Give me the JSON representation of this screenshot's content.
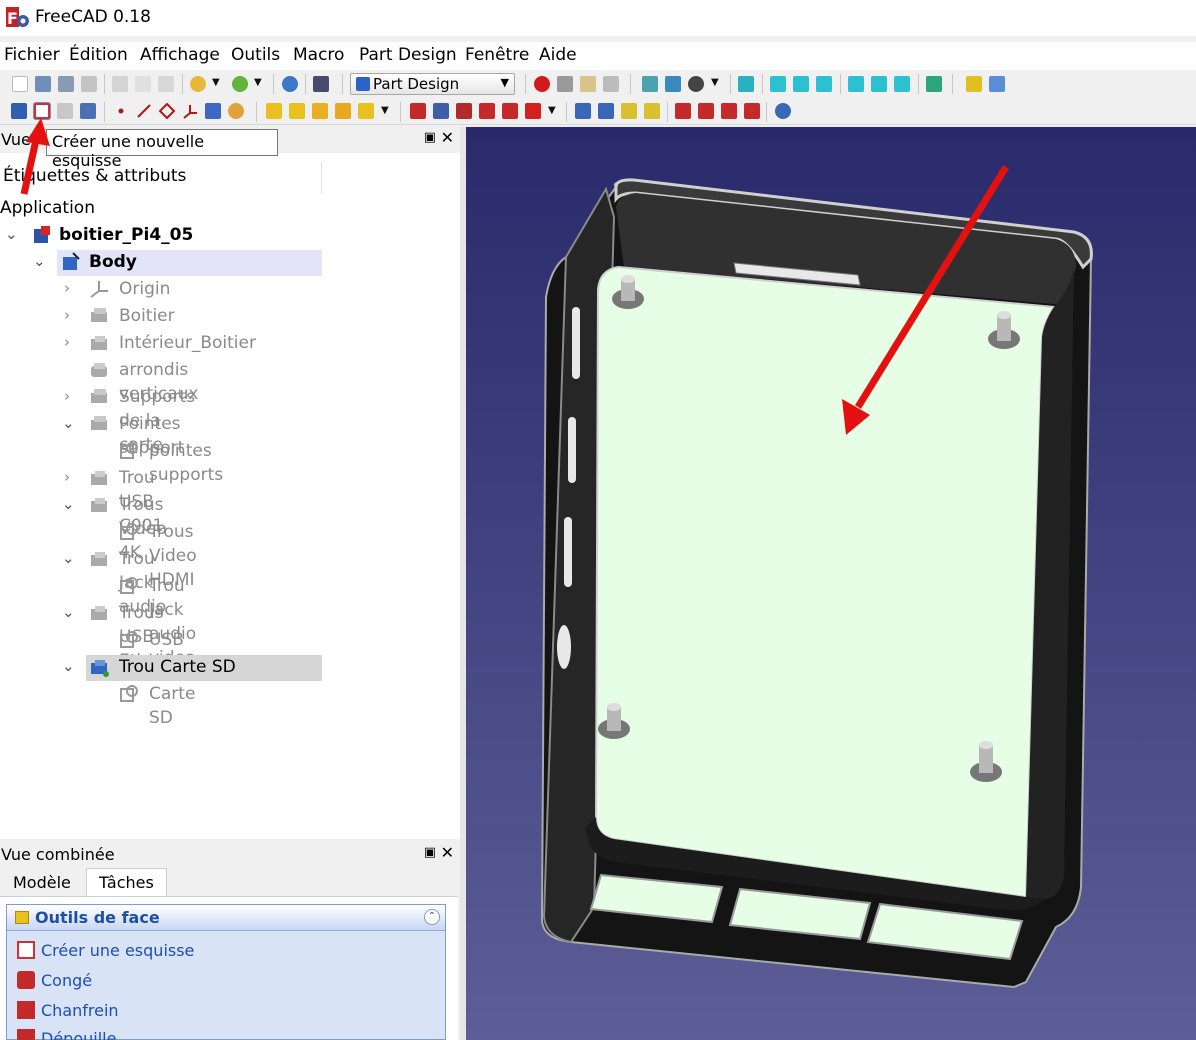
{
  "window": {
    "title": "FreeCAD 0.18"
  },
  "menu": [
    "Fichier",
    "Édition",
    "Affichage",
    "Outils",
    "Macro",
    "Part Design",
    "Fenêtre",
    "Aide"
  ],
  "toolbar": {
    "workbench": "Part Design",
    "tooltip": "Créer une nouvelle esquisse"
  },
  "tree_panel": {
    "title": "Vue",
    "column_header": "Étiquettes & attributs",
    "section": "Application",
    "items": [
      {
        "label": "boitier_Pi4_05",
        "bold": true
      },
      {
        "label": "Body",
        "bold": true
      },
      {
        "label": "Origin"
      },
      {
        "label": "Boitier"
      },
      {
        "label": "Intérieur_Boitier"
      },
      {
        "label": "arrondis verticaux"
      },
      {
        "label": "Supports de la carte"
      },
      {
        "label": "Pointes support"
      },
      {
        "label": "pointes supports"
      },
      {
        "label": "Trou USB C001"
      },
      {
        "label": "Trous Video 4K"
      },
      {
        "label": "Trous Video HDMI"
      },
      {
        "label": "Trou Jack audio"
      },
      {
        "label": "Trou Jack audio video"
      },
      {
        "label": "Trous USB Ethernet"
      },
      {
        "label": "USB Ethernet"
      },
      {
        "label": "Trou Carte SD"
      },
      {
        "label": "Carte SD"
      }
    ]
  },
  "combo": {
    "title": "Vue combinée",
    "tabs": [
      "Modèle",
      "Tâches"
    ],
    "task_title": "Outils de face",
    "task_items": [
      "Créer une esquisse",
      "Congé",
      "Chanfrein",
      "Dépouille"
    ]
  },
  "colors": {
    "selection": "#e4e4f8",
    "face_highlight": "#e6fde6",
    "viewport_top": "#282a6b",
    "viewport_bottom": "#5d5e97",
    "arrow": "#e41111"
  }
}
